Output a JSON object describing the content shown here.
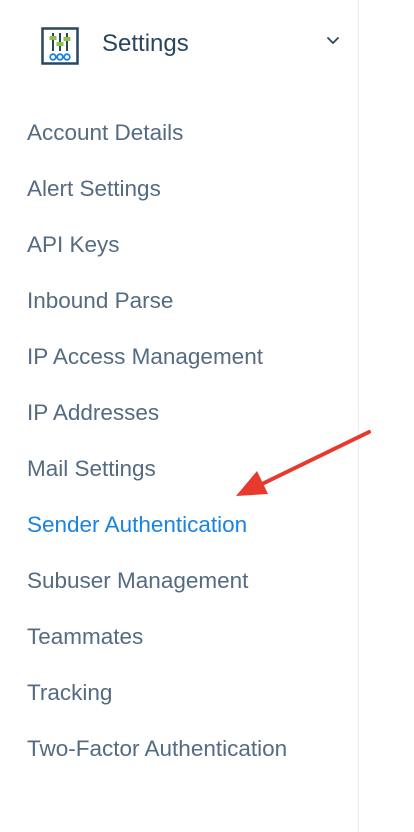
{
  "header": {
    "title": "Settings",
    "icon": "sliders-icon",
    "expand_icon": "chevron-down-icon",
    "icon_colors": {
      "frame": "#294661",
      "green": "#8bc34a",
      "blue": "#1a82e2"
    }
  },
  "nav": {
    "items": [
      {
        "label": "Account Details"
      },
      {
        "label": "Alert Settings"
      },
      {
        "label": "API Keys"
      },
      {
        "label": "Inbound Parse"
      },
      {
        "label": "IP Access Management"
      },
      {
        "label": "IP Addresses"
      },
      {
        "label": "Mail Settings"
      },
      {
        "label": "Sender Authentication",
        "active": true
      },
      {
        "label": "Subuser Management"
      },
      {
        "label": "Teammates"
      },
      {
        "label": "Tracking"
      },
      {
        "label": "Two-Factor Authentication"
      }
    ]
  },
  "colors": {
    "text": "#546b81",
    "heading": "#294661",
    "active": "#1a82e2",
    "annotation_arrow": "#e8392f"
  }
}
